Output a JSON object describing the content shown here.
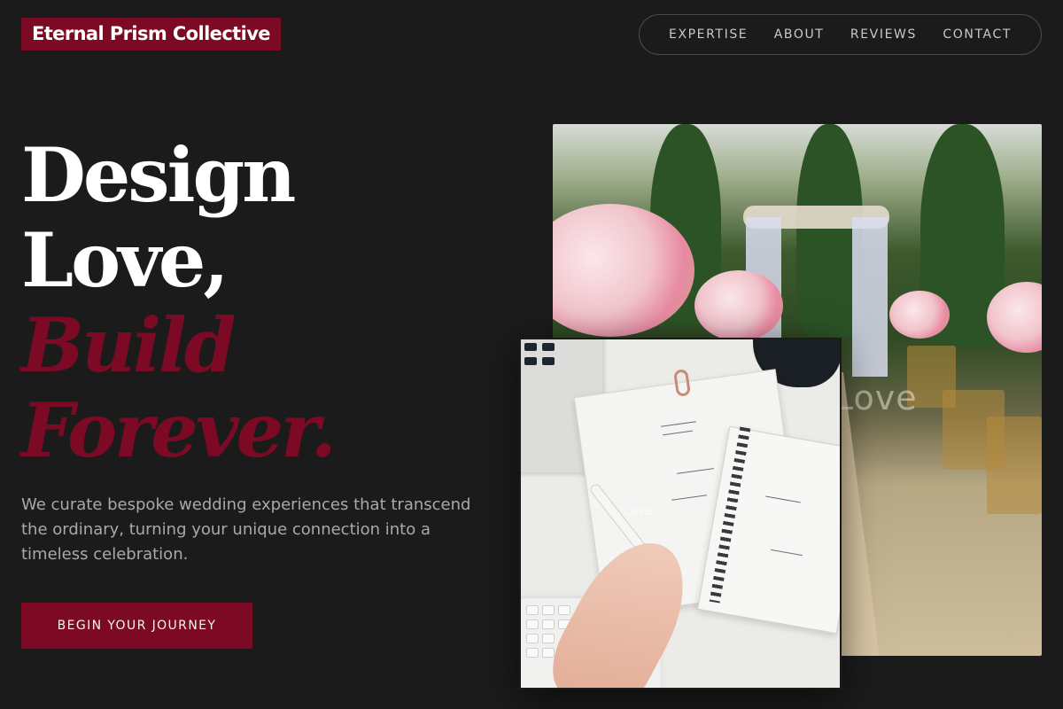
{
  "brand": {
    "name": "Eternal Prism Collective"
  },
  "nav": {
    "items": [
      "EXPERTISE",
      "ABOUT",
      "REVIEWS",
      "CONTACT"
    ]
  },
  "hero": {
    "lines": [
      "Design",
      "Love,",
      "Build",
      "Forever."
    ],
    "tagline": "We curate bespoke wedding experiences that transcend the ordinary, turning your unique connection into a timeless celebration.",
    "cta": "BEGIN YOUR JOURNEY"
  },
  "images": {
    "back_overlay": "Love",
    "front_overlay": "Love"
  },
  "colors": {
    "background": "#1b1b1c",
    "accent": "#7d0a24",
    "text_primary": "#ffffff",
    "text_muted": "#a9a9a9"
  }
}
